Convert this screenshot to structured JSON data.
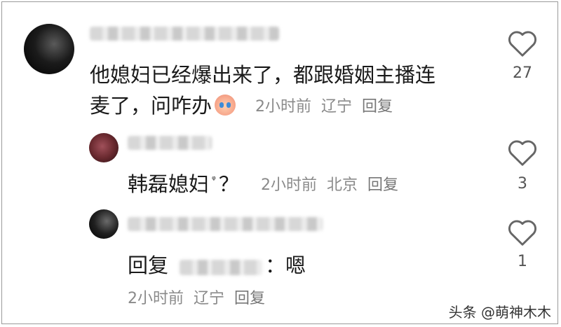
{
  "comments": [
    {
      "text": "他媳妇已经爆出来了，都跟婚姻主播连",
      "text_line2": "麦了，问咋办",
      "emoji": "crying-face-emoji",
      "time": "2小时前",
      "location": "辽宁",
      "reply_label": "回复",
      "likes": "27"
    },
    {
      "text": "韩磊媳妇",
      "suffix": "？",
      "time": "2小时前",
      "location": "北京",
      "reply_label": "回复",
      "likes": "3"
    },
    {
      "prefix": "回复",
      "colon_text": "：嗯",
      "time": "2小时前",
      "location": "辽宁",
      "reply_label": "回复",
      "likes": "1"
    }
  ],
  "watermark": "头条 @萌神木木",
  "colors": {
    "text": "#1a1a1a",
    "meta": "#8a8a8a",
    "like": "#666666"
  }
}
